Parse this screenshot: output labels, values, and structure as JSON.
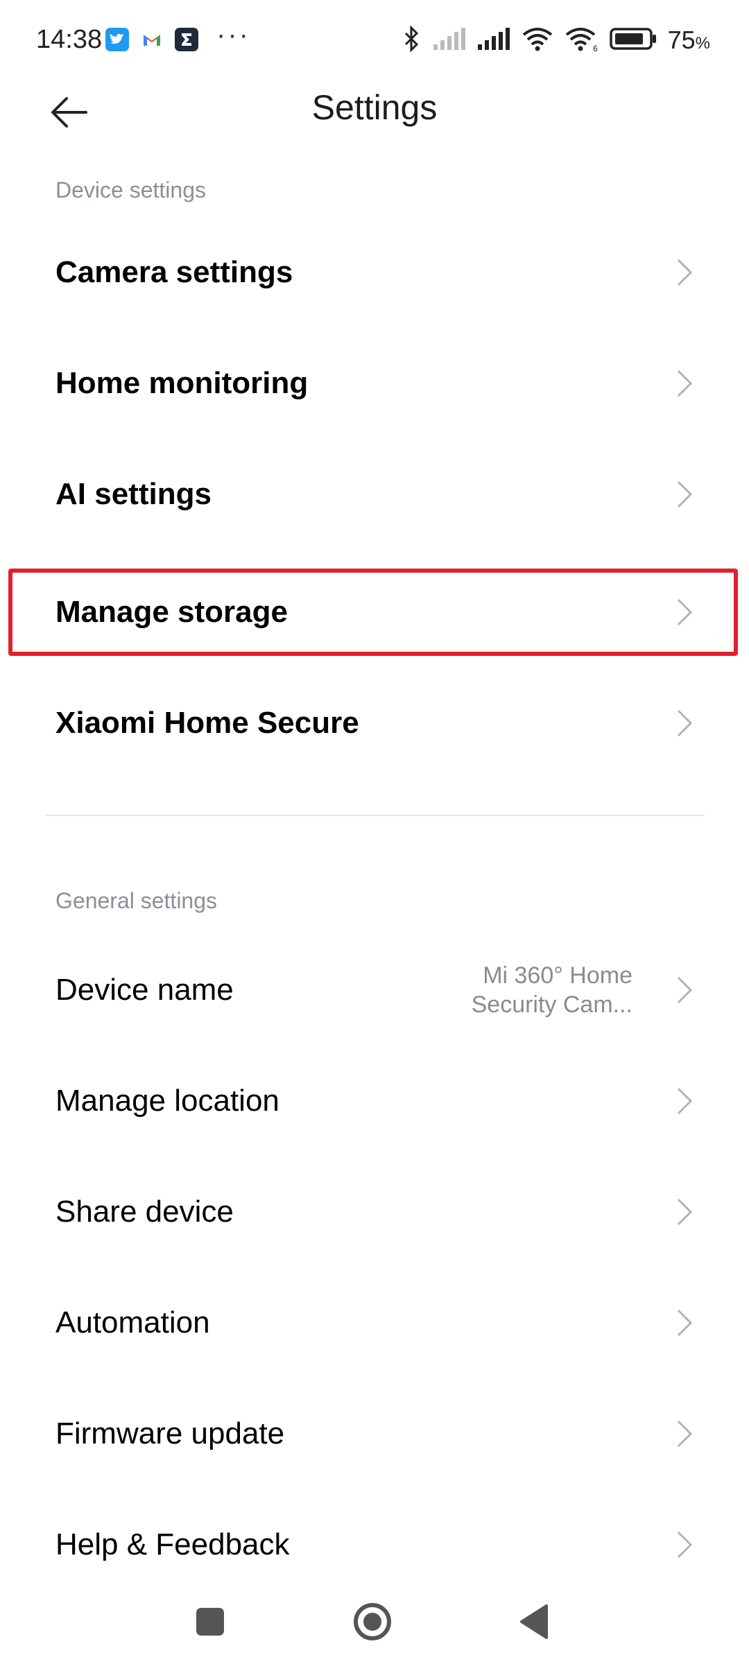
{
  "status_bar": {
    "time": "14:38",
    "battery_percent": "75",
    "battery_unit": "%",
    "icons": [
      "twitter-icon",
      "gmail-icon",
      "sigma-app-icon",
      "more-icon",
      "bluetooth-icon",
      "signal-icon",
      "signal-icon",
      "wifi-icon",
      "wifi-6-icon",
      "battery-icon"
    ]
  },
  "header": {
    "title": "Settings",
    "back_icon": "arrow-left-icon"
  },
  "device_settings": {
    "label": "Device settings",
    "items": [
      {
        "label": "Camera settings"
      },
      {
        "label": "Home monitoring"
      },
      {
        "label": "AI settings"
      },
      {
        "label": "Manage storage",
        "highlighted": true
      },
      {
        "label": "Xiaomi Home Secure"
      }
    ]
  },
  "general_settings": {
    "label": "General settings",
    "items": [
      {
        "label": "Device name",
        "value_line1": "Mi 360° Home",
        "value_line2": "Security Cam..."
      },
      {
        "label": "Manage location"
      },
      {
        "label": "Share device"
      },
      {
        "label": "Automation"
      },
      {
        "label": "Firmware update"
      },
      {
        "label": "Help & Feedback"
      }
    ]
  },
  "colors": {
    "highlight": "#e1222e",
    "section_label": "#8a8f99",
    "chevron": "#b3b3b3"
  }
}
